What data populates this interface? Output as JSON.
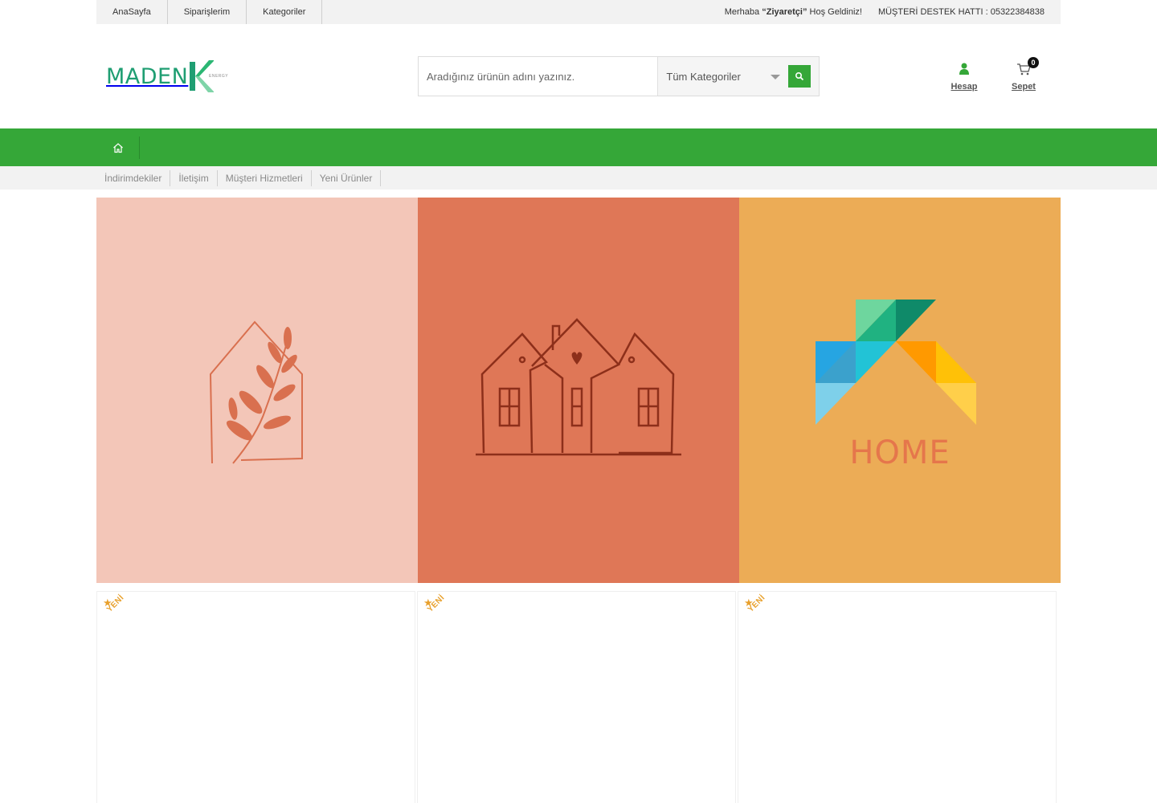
{
  "topbar": {
    "links": [
      "AnaSayfa",
      "Siparişlerim",
      "Kategoriler"
    ],
    "greeting_prefix": "Merhaba ",
    "greeting_name": "“Ziyaretçi”",
    "greeting_suffix": " Hoş Geldiniz!",
    "support": "MÜŞTERİ DESTEK HATTI : 05322384838"
  },
  "header": {
    "logo_text": "MADEN",
    "logo_sub": "ENERGY",
    "search_placeholder": "Aradığınız ürünün adını yazınız.",
    "category_select": "Tüm Kategoriler",
    "account_label": "Hesap",
    "cart_label": "Sepet",
    "cart_count": "0"
  },
  "subnav": {
    "links": [
      "İndirimdekiler",
      "İletişim",
      "Müşteri Hizmetleri",
      "Yeni Ürünler"
    ]
  },
  "banners": {
    "colors": [
      "#f3c6b8",
      "#df7757",
      "#ecac56"
    ],
    "third_text": "HOME"
  },
  "products": {
    "badges": [
      "YENİ",
      "YENİ",
      "YENİ"
    ]
  },
  "colors": {
    "accent": "#35a738",
    "logo": "#1f9e72",
    "badge": "#e8a02c"
  }
}
